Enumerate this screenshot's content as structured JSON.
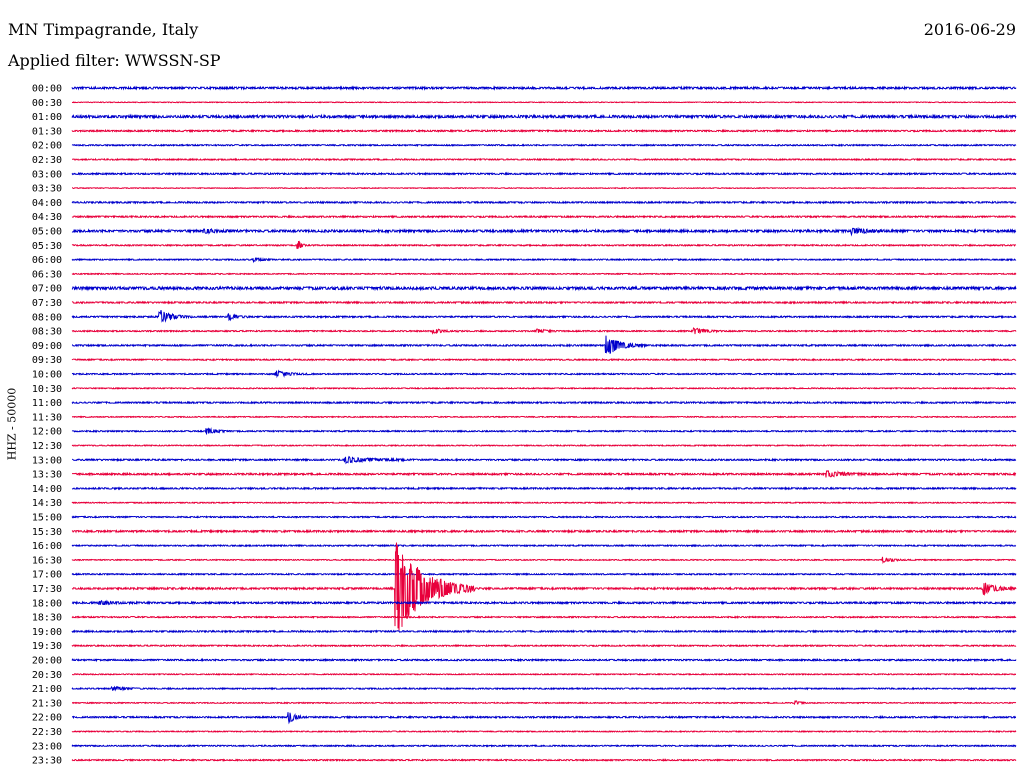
{
  "header": {
    "station": "MN Timpagrande, Italy",
    "date": "2016-06-29",
    "filter": "Applied filter: WWSSN-SP"
  },
  "chart_data": {
    "type": "line",
    "subtype": "helicorder",
    "ylabel": "HHZ - 50000",
    "tick_labels": [
      "00:00",
      "00:30",
      "01:00",
      "01:30",
      "02:00",
      "02:30",
      "03:00",
      "03:30",
      "04:00",
      "04:30",
      "05:00",
      "05:30",
      "06:00",
      "06:30",
      "07:00",
      "07:30",
      "08:00",
      "08:30",
      "09:00",
      "09:30",
      "10:00",
      "10:30",
      "11:00",
      "11:30",
      "12:00",
      "12:30",
      "13:00",
      "13:30",
      "14:00",
      "14:30",
      "15:00",
      "15:30",
      "16:00",
      "16:30",
      "17:00",
      "17:30",
      "18:00",
      "18:30",
      "19:00",
      "19:30",
      "20:00",
      "20:30",
      "21:00",
      "21:30",
      "22:00",
      "22:30",
      "23:00",
      "23:30"
    ],
    "colors": [
      "#0000cc",
      "#e8003c"
    ],
    "x_range_minutes": [
      0,
      30
    ],
    "noise": [
      0.8,
      0.3,
      1.0,
      0.6,
      0.5,
      0.5,
      0.6,
      0.3,
      0.6,
      0.6,
      0.9,
      0.5,
      0.5,
      0.4,
      1.1,
      0.6,
      0.6,
      0.5,
      0.6,
      0.5,
      0.5,
      0.4,
      0.6,
      0.4,
      0.5,
      0.4,
      0.6,
      0.7,
      0.6,
      0.4,
      0.5,
      0.7,
      0.5,
      0.4,
      0.5,
      0.7,
      0.7,
      0.5,
      0.6,
      0.5,
      0.6,
      0.4,
      0.5,
      0.4,
      0.6,
      0.4,
      0.5,
      0.5
    ],
    "events": [
      {
        "row": 10,
        "t": 4.2,
        "amp": 2,
        "dur": 1.2
      },
      {
        "row": 10,
        "t": 24.8,
        "amp": 3,
        "dur": 1.3
      },
      {
        "row": 11,
        "t": 7.2,
        "amp": 4,
        "dur": 0.3
      },
      {
        "row": 12,
        "t": 5.8,
        "amp": 2,
        "dur": 0.6
      },
      {
        "row": 16,
        "t": 2.8,
        "amp": 7,
        "dur": 1.0
      },
      {
        "row": 16,
        "t": 5.0,
        "amp": 3,
        "dur": 0.7
      },
      {
        "row": 17,
        "t": 11.5,
        "amp": 2,
        "dur": 1.0
      },
      {
        "row": 17,
        "t": 14.8,
        "amp": 2,
        "dur": 0.8
      },
      {
        "row": 17,
        "t": 19.8,
        "amp": 3,
        "dur": 1.0
      },
      {
        "row": 18,
        "t": 17.0,
        "amp": 10,
        "dur": 1.2
      },
      {
        "row": 20,
        "t": 6.5,
        "amp": 3,
        "dur": 1.2
      },
      {
        "row": 24,
        "t": 4.3,
        "amp": 3,
        "dur": 0.8
      },
      {
        "row": 26,
        "t": 8.7,
        "amp": 3,
        "dur": 2.2
      },
      {
        "row": 27,
        "t": 24.0,
        "amp": 3,
        "dur": 1.5
      },
      {
        "row": 35,
        "t": 10.3,
        "amp": 48,
        "dur": 2.5
      },
      {
        "row": 35,
        "t": 29.0,
        "amp": 6,
        "dur": 1.0
      },
      {
        "row": 36,
        "t": 0.9,
        "amp": 2,
        "dur": 1.2
      },
      {
        "row": 33,
        "t": 25.8,
        "amp": 3,
        "dur": 0.8
      },
      {
        "row": 42,
        "t": 1.3,
        "amp": 2,
        "dur": 1.0
      },
      {
        "row": 44,
        "t": 6.9,
        "amp": 6,
        "dur": 0.5
      },
      {
        "row": 43,
        "t": 23.0,
        "amp": 2,
        "dur": 0.4
      }
    ]
  }
}
